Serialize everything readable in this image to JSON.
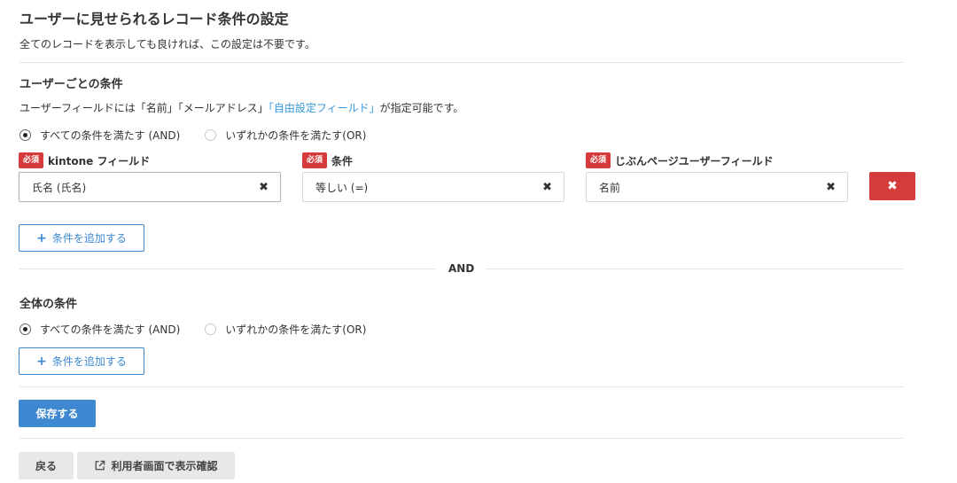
{
  "header": {
    "title": "ユーザーに見せられるレコード条件の設定",
    "description": "全てのレコードを表示しても良ければ、この設定は不要です。"
  },
  "user_conditions": {
    "title": "ユーザーごとの条件",
    "help_prefix": "ユーザーフィールドには「名前」「メールアドレス」",
    "help_link": "「自由設定フィールド」",
    "help_suffix": "が指定可能です。",
    "radio_and": "すべての条件を満たす (AND)",
    "radio_or": "いずれかの条件を満たす(OR)",
    "selected": "and",
    "required_badge": "必須",
    "field_label": "kintone フィールド",
    "condition_label": "条件",
    "user_field_label": "じぶんページユーザーフィールド",
    "row": {
      "field_value": "氏名 (氏名)",
      "condition_value": "等しい (=)",
      "user_field_value": "名前"
    },
    "add_label": "条件を追加する"
  },
  "separator": {
    "label": "AND"
  },
  "global_conditions": {
    "title": "全体の条件",
    "radio_and": "すべての条件を満たす (AND)",
    "radio_or": "いずれかの条件を満たす(OR)",
    "selected": "and",
    "add_label": "条件を追加する"
  },
  "actions": {
    "save_label": "保存する",
    "back_label": "戻る",
    "preview_label": "利用者画面で表示確認"
  },
  "icons": {
    "clear": "close-icon",
    "delete": "close-icon",
    "add": "plus-icon",
    "external": "external-link-icon"
  },
  "colors": {
    "primary": "#3d88d1",
    "danger": "#d63b3b",
    "link": "#3498db"
  }
}
